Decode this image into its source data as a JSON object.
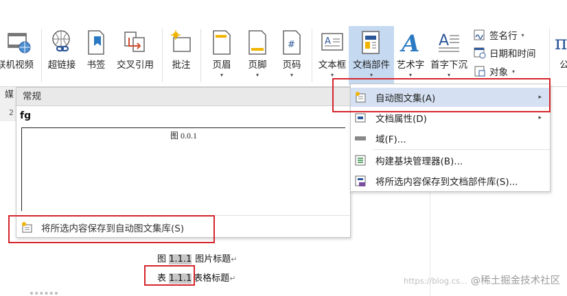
{
  "ribbon": {
    "buttons": [
      {
        "label": "联机视频",
        "icon": "online-video-icon",
        "caret": false
      },
      {
        "label": "超链接",
        "icon": "hyperlink-icon",
        "caret": false
      },
      {
        "label": "书签",
        "icon": "bookmark-icon",
        "caret": false
      },
      {
        "label": "交叉引用",
        "icon": "cross-reference-icon",
        "caret": false
      },
      {
        "label": "批注",
        "icon": "comment-icon",
        "caret": false
      },
      {
        "label": "页眉",
        "icon": "header-icon",
        "caret": true
      },
      {
        "label": "页脚",
        "icon": "footer-icon",
        "caret": true
      },
      {
        "label": "页码",
        "icon": "page-number-icon",
        "caret": true
      },
      {
        "label": "文本框",
        "icon": "textbox-icon",
        "caret": true
      },
      {
        "label": "文档部件",
        "icon": "quick-parts-icon",
        "caret": true
      },
      {
        "label": "艺术字",
        "icon": "wordart-icon",
        "caret": true
      },
      {
        "label": "首字下沉",
        "icon": "drop-cap-icon",
        "caret": true
      }
    ],
    "small_buttons": [
      {
        "label": "签名行",
        "icon": "signature-line-icon",
        "caret": true
      },
      {
        "label": "日期和时间",
        "icon": "date-time-icon",
        "caret": false
      },
      {
        "label": "对象",
        "icon": "object-icon",
        "caret": true
      }
    ],
    "cut_label": "公",
    "group_label_partial": "媒",
    "caret_glyph": "▾"
  },
  "gallery": {
    "header": "常规",
    "entry_name": "fg",
    "preview_text": "图 0.0.1",
    "save_label": "将所选内容保存到自动图文集库(S)"
  },
  "menu": {
    "items": [
      {
        "label": "自动图文集(A)",
        "icon": "autotext-icon",
        "submenu": true,
        "highlighted": true
      },
      {
        "label": "文档属性(D)",
        "icon": "document-property-icon",
        "submenu": true,
        "highlighted": false
      },
      {
        "label": "域(F)...",
        "icon": "field-icon",
        "submenu": false,
        "highlighted": false
      },
      {
        "label": "构建基块管理器(B)...",
        "icon": "building-blocks-organizer-icon",
        "submenu": false,
        "highlighted": false
      },
      {
        "label": "将所选内容保存到文档部件库(S)...",
        "icon": "save-to-gallery-icon",
        "submenu": false,
        "highlighted": false
      }
    ],
    "arrow_glyph": "▸"
  },
  "document": {
    "row_marker": "2",
    "figure_prefix": "图",
    "figure_number": "1.1.1",
    "figure_title": "图片标题",
    "table_prefix": "表",
    "table_number": "1.1.1",
    "table_title": "表格标题",
    "para_mark": "↵"
  },
  "watermark": {
    "url": "https://blog.cs...",
    "text": "@稀土掘金技术社区"
  },
  "colors": {
    "highlight_box": "#d4242b",
    "menu_hover": "#d5e1f2",
    "icon_blue": "#2b579a"
  }
}
